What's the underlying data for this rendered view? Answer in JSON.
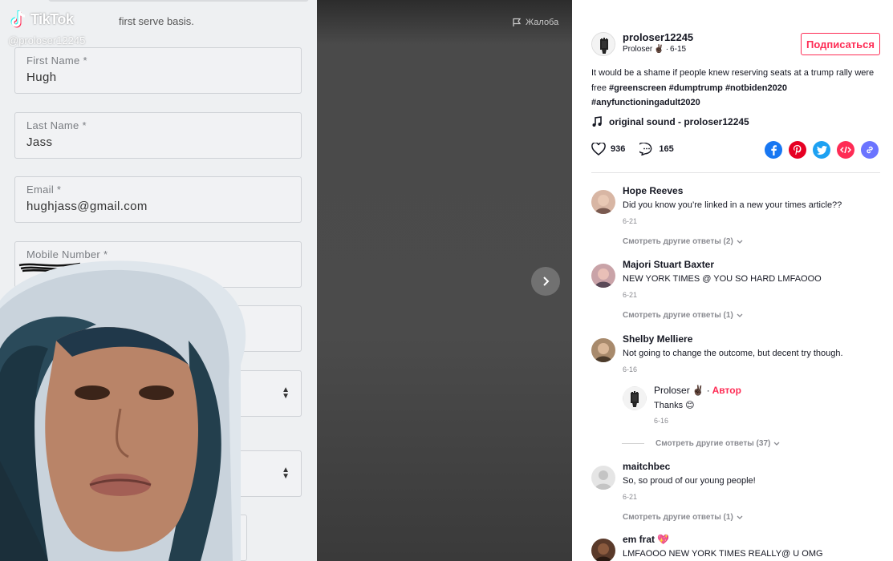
{
  "video": {
    "logo_text": "TikTok",
    "handle_watermark": "@proloser12245",
    "report_label": "Жалоба",
    "form": {
      "serve_text": "first serve basis.",
      "fields": [
        {
          "label": "First Name *",
          "value": "Hugh"
        },
        {
          "label": "Last Name *",
          "value": "Jass"
        },
        {
          "label": "Email *",
          "value": "hughjass@gmail.com"
        },
        {
          "label": "Mobile Number *",
          "value": ""
        }
      ]
    }
  },
  "panel": {
    "author": {
      "username": "proloser12245",
      "display_name": "Proloser",
      "emoji": "✌🏿",
      "date": "6-15",
      "follow_label": "Подписаться"
    },
    "caption": {
      "text": "It would be a shame if people knew reserving seats at a trump rally were free",
      "hashtags": [
        "#greenscreen",
        "#dumptrump",
        "#notbiden2020",
        "#anyfunctioningadult2020"
      ]
    },
    "sound": "original sound - proloser12245",
    "likes": "936",
    "comments_count": "165",
    "share_icons": [
      "facebook-icon",
      "pinterest-icon",
      "twitter-icon",
      "embed-icon",
      "link-icon"
    ],
    "colors": {
      "accent": "#fe2c55",
      "facebook": "#1877f2",
      "pinterest": "#e60023",
      "twitter": "#1da1f2",
      "embed": "#fe2c55",
      "link": "#6b74ff"
    },
    "comments": [
      {
        "name": "Hope Reeves",
        "text": "Did you know you’re linked in a new your times article??",
        "date": "6-21",
        "more": "Смотреть другие ответы (2)"
      },
      {
        "name": "Majori Stuart Baxter",
        "text": "NEW YORK TIMES @ YOU SO HARD LMFAOOO",
        "date": "6-21",
        "more": "Смотреть другие ответы (1)"
      },
      {
        "name": "Shelby Melliere",
        "text": "Not going to change the outcome, but decent try though.",
        "date": "6-16",
        "reply": {
          "name": "Proloser",
          "emoji": "✌🏿",
          "author_label": "Автор",
          "text": "Thanks",
          "text_emoji": "😊",
          "date": "6-16"
        },
        "more": "Смотреть другие ответы (37)"
      },
      {
        "name": "maitchbec",
        "text": "So, so proud of our young people!",
        "date": "6-21",
        "more": "Смотреть другие ответы (1)"
      },
      {
        "name": "em frat",
        "name_emoji": "💖",
        "text": "LMFAOOO NEW YORK TIMES REALLY@ U OMG",
        "date": "",
        "more": ""
      }
    ]
  }
}
